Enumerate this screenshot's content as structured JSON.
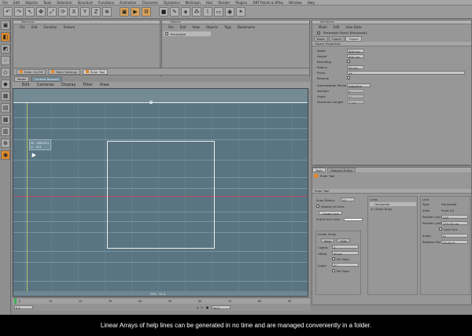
{
  "menubar": {
    "items": [
      "File",
      "Edit",
      "Objects",
      "Tools",
      "Selection",
      "Structure",
      "Functions",
      "Animation",
      "Character",
      "Dynamics",
      "MoGraph",
      "Hair",
      "Render",
      "Plugins",
      "DRT Paints & Effex",
      "Window",
      "Help"
    ]
  },
  "toolbar": {
    "icons": [
      "undo-icon",
      "redo-icon",
      "select-icon",
      "move-icon",
      "scale-icon",
      "rotate-icon",
      "x-axis-icon",
      "y-axis-icon",
      "z-axis-icon",
      "world-icon",
      "render-view-icon",
      "render-icon",
      "render-settings-icon",
      "cube-icon",
      "pen-icon",
      "subdivide-icon",
      "array-icon",
      "deformer-icon",
      "floor-icon",
      "camera-icon",
      "light-icon"
    ]
  },
  "materials_panel": {
    "title": "Materials",
    "menu": [
      "File",
      "Edit",
      "Function",
      "Texture"
    ]
  },
  "objects_panel": {
    "title": "Objects",
    "menu": [
      "File",
      "Edit",
      "View",
      "Objects",
      "Tags",
      "Bookmarks"
    ],
    "item": "Rectangle"
  },
  "attributes_panel": {
    "title": "Attributes",
    "menu": [
      "Mode",
      "Edit",
      "User Data"
    ],
    "object_name": "Rectangle Object [Rectangle]",
    "tabs": [
      "Basic",
      "Coord.",
      "Object"
    ],
    "section": "Object Properties",
    "props": [
      {
        "label": "Width",
        "value": "400 cm"
      },
      {
        "label": "Height",
        "value": "400 cm"
      },
      {
        "label": "Rounding",
        "value": ""
      },
      {
        "label": "Radius",
        "value": "50 cm"
      },
      {
        "label": "Plane",
        "value": "XY"
      },
      {
        "label": "Reverse",
        "value": ""
      }
    ],
    "interp": [
      {
        "label": "Intermediate Points",
        "value": "Adaptive"
      },
      {
        "label": "Number",
        "value": "8"
      },
      {
        "label": "Angle",
        "value": "5°"
      },
      {
        "label": "Maximum Length",
        "value": "5 cm"
      }
    ]
  },
  "tool_tabs": [
    "Ruler On/Off",
    "Ruler Settings",
    "Ruler Tool"
  ],
  "viewport": {
    "tabs": [
      "Model",
      "Content Browser"
    ],
    "menu": [
      "Edit",
      "Cameras",
      "Display",
      "Filter",
      "View"
    ],
    "readout_1": "W - 458.021",
    "readout_2": "H - 421",
    "status": "FPS : 72.0"
  },
  "tools_panel": {
    "tabs": [
      "Tools",
      "Material Editor"
    ],
    "tool_name": "Ruler Tool",
    "section": "Ruler Tool",
    "snap_label": "Snap Radius",
    "snap_value": "10",
    "display_all_lines": "Display all lines",
    "create_button": "Create Line",
    "active_line_color": "Active line color",
    "linear_array_title": "Linear Array",
    "new_btn": "New",
    "edit_btn": "Edit",
    "copies_label": "Copies",
    "copies_value": "2",
    "offset_label": "Offset",
    "offset_value": "40 px",
    "per_step_1": "Per Step",
    "angle_label": "Angle",
    "angle_value": "0°",
    "per_step_2": "Per Step",
    "lines_title": "Lines",
    "lines_items": [
      "Horizontal",
      "Linear Array"
    ],
    "line_title": "Line",
    "line_props": [
      {
        "label": "Type",
        "value": "Horizontal"
      },
      {
        "label": "View",
        "value": "Front (Z)"
      },
      {
        "label": "Position (px)",
        "value": "245"
      },
      {
        "label": "Position (unit)",
        "value": "173.33 cm"
      },
      {
        "label": "Lock Line",
        "value": ""
      },
      {
        "label": "Angle",
        "value": "0°"
      },
      {
        "label": "Relative Pos",
        "value": "25.00 %"
      }
    ]
  },
  "timeline": {
    "start": "0 F",
    "end": "90 F",
    "ticks": [
      "0",
      "10",
      "20",
      "30",
      "40",
      "50",
      "60",
      "70",
      "80",
      "90"
    ]
  },
  "subtitle": "Linear Arrays of help lines can be generated in no time and are managed conveniently in a folder.",
  "colors": {
    "viewport_bg": "#5a7581",
    "guide": "#b34a5a",
    "accent_orange": "#e08a2a"
  }
}
